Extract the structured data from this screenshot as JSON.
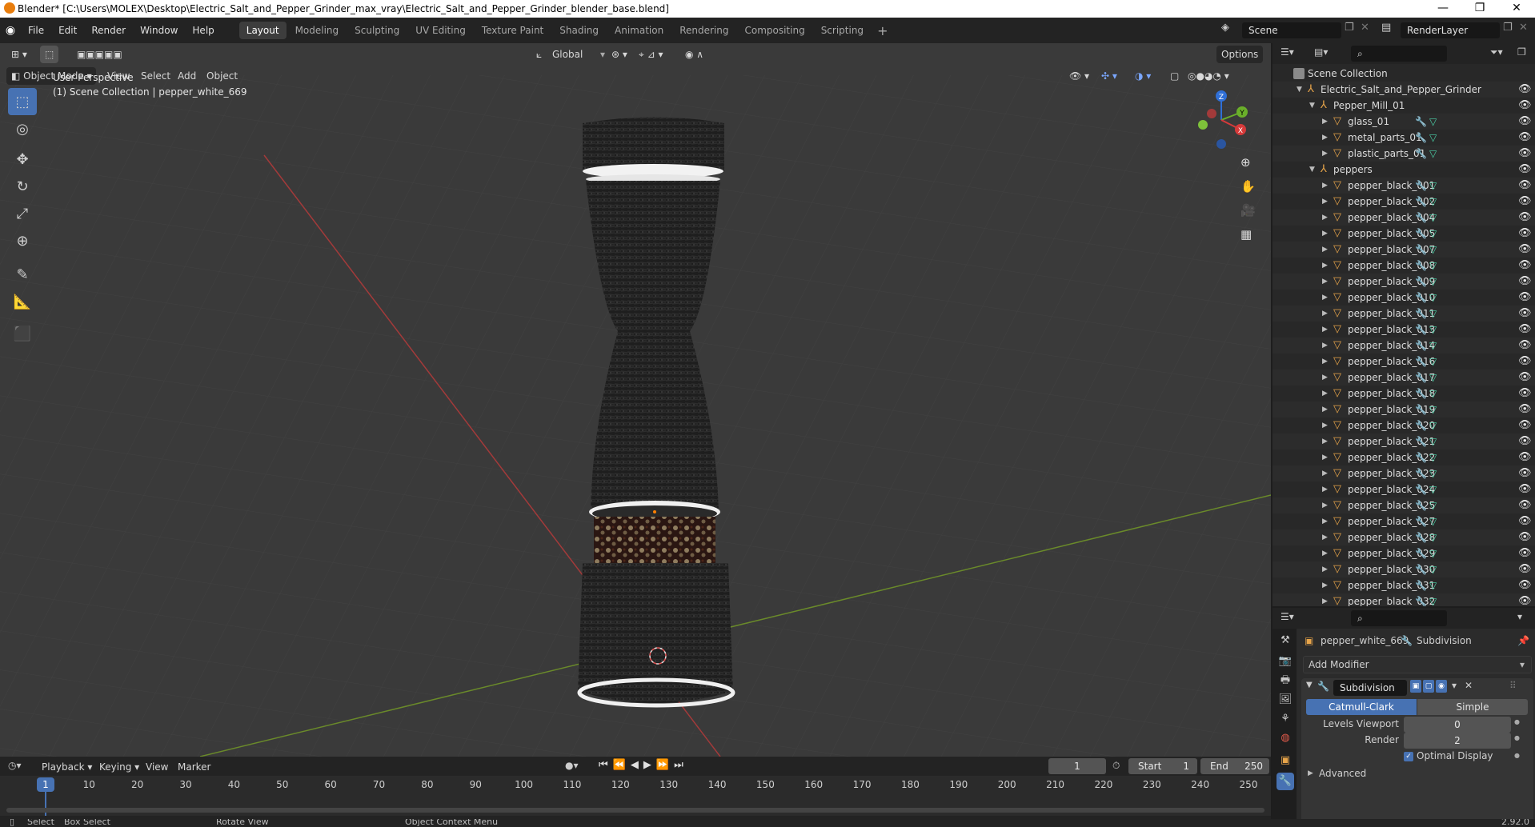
{
  "window": {
    "title": "Blender* [C:\\Users\\MOLEX\\Desktop\\Electric_Salt_and_Pepper_Grinder_max_vray\\Electric_Salt_and_Pepper_Grinder_blender_base.blend]",
    "min": "—",
    "max": "❐",
    "close": "✕"
  },
  "menu": [
    "File",
    "Edit",
    "Render",
    "Window",
    "Help"
  ],
  "workspaces": [
    "Layout",
    "Modeling",
    "Sculpting",
    "UV Editing",
    "Texture Paint",
    "Shading",
    "Animation",
    "Rendering",
    "Compositing",
    "Scripting"
  ],
  "active_workspace": "Layout",
  "scene": {
    "name": "Scene",
    "view_layer": "RenderLayer"
  },
  "viewport": {
    "mode": "Object Mode",
    "menus": [
      "View",
      "Select",
      "Add",
      "Object"
    ],
    "transform_orientation": "Global",
    "options_label": "Options",
    "perspective": "User Perspective",
    "context": "(1) Scene Collection | pepper_white_669",
    "gizmo": {
      "z": "Z",
      "y": "Y",
      "x": "X"
    }
  },
  "outliner": {
    "root": "Scene Collection",
    "collection": "Electric_Salt_and_Pepper_Grinder",
    "mill": "Pepper_Mill_01",
    "mill_objects": [
      "glass_01",
      "metal_parts_01",
      "plastic_parts_01"
    ],
    "peppers": "peppers",
    "pepper_objects": [
      "pepper_black_001",
      "pepper_black_002",
      "pepper_black_004",
      "pepper_black_005",
      "pepper_black_007",
      "pepper_black_008",
      "pepper_black_009",
      "pepper_black_010",
      "pepper_black_011",
      "pepper_black_013",
      "pepper_black_014",
      "pepper_black_016",
      "pepper_black_017",
      "pepper_black_018",
      "pepper_black_019",
      "pepper_black_020",
      "pepper_black_021",
      "pepper_black_022",
      "pepper_black_023",
      "pepper_black_024",
      "pepper_black_025",
      "pepper_black_027",
      "pepper_black_028",
      "pepper_black_029",
      "pepper_black_030",
      "pepper_black_031",
      "pepper_black_032"
    ]
  },
  "properties": {
    "object_name": "pepper_white_669",
    "modifier_name_header": "Subdivision",
    "add_modifier": "Add Modifier",
    "modifier_name": "Subdivision",
    "type_catmull": "Catmull-Clark",
    "type_simple": "Simple",
    "levels_viewport_label": "Levels Viewport",
    "levels_viewport": "0",
    "render_label": "Render",
    "render_value": "2",
    "optimal_display": "Optimal Display",
    "advanced": "Advanced"
  },
  "timeline": {
    "menus": [
      "Playback",
      "Keying",
      "View",
      "Marker"
    ],
    "current_frame": "1",
    "start_label": "Start",
    "start": "1",
    "end_label": "End",
    "end": "250",
    "ruler": [
      "1",
      "10",
      "20",
      "30",
      "40",
      "50",
      "60",
      "70",
      "80",
      "90",
      "100",
      "110",
      "120",
      "130",
      "140",
      "150",
      "160",
      "170",
      "180",
      "190",
      "200",
      "210",
      "220",
      "230",
      "240",
      "250"
    ]
  },
  "status": {
    "select": "Select",
    "box_select": "Box Select",
    "rotate_view": "Rotate View",
    "context_menu": "Object Context Menu",
    "version": "2.92.0"
  }
}
